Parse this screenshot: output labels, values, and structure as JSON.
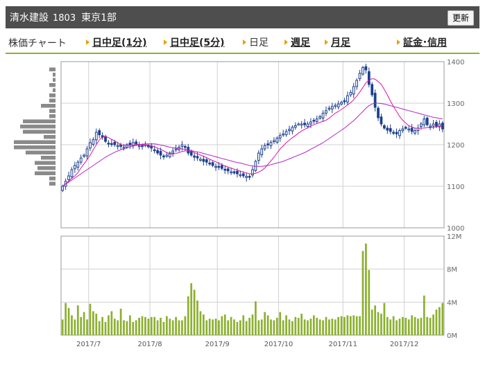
{
  "header": {
    "company": "清水建設",
    "code": "1803",
    "market": "東京1部",
    "refresh_label": "更新"
  },
  "nav": {
    "label": "株価チャート",
    "items": [
      {
        "label": "日中足(1分)",
        "current": false
      },
      {
        "label": "日中足(5分)",
        "current": false
      },
      {
        "label": "日足",
        "current": true
      },
      {
        "label": "週足",
        "current": false
      },
      {
        "label": "月足",
        "current": false
      },
      {
        "label": "証金･信用",
        "current": false
      }
    ]
  },
  "colors": {
    "candle": "#1a3f8f",
    "ma_short": "#d8159e",
    "ma_long": "#b023c8",
    "volume": "#8db030",
    "profile": "#8a8a8a",
    "grid": "#d0d0d0",
    "header_bg": "#4e4e4e"
  },
  "chart_data": [
    {
      "type": "candlestick",
      "x_ticks": [
        "2017/7",
        "2017/8",
        "2017/9",
        "2017/10",
        "2017/11",
        "2017/12"
      ],
      "y_ticks": [
        1400,
        1300,
        1200,
        1100,
        1000
      ],
      "ylim": [
        1000,
        1400
      ],
      "grid": true,
      "x": [
        "2017/6/20",
        "2017/6/21",
        "2017/6/22",
        "2017/6/23",
        "2017/6/26",
        "2017/6/27",
        "2017/6/28",
        "2017/6/29",
        "2017/6/30",
        "2017/7/3",
        "2017/7/4",
        "2017/7/5",
        "2017/7/6",
        "2017/7/7",
        "2017/7/10",
        "2017/7/11",
        "2017/7/12",
        "2017/7/13",
        "2017/7/14",
        "2017/7/18",
        "2017/7/19",
        "2017/7/20",
        "2017/7/21",
        "2017/7/24",
        "2017/7/25",
        "2017/7/26",
        "2017/7/27",
        "2017/7/28",
        "2017/7/31",
        "2017/8/1",
        "2017/8/2",
        "2017/8/3",
        "2017/8/4",
        "2017/8/7",
        "2017/8/8",
        "2017/8/9",
        "2017/8/10",
        "2017/8/14",
        "2017/8/15",
        "2017/8/16",
        "2017/8/17",
        "2017/8/18",
        "2017/8/21",
        "2017/8/22",
        "2017/8/23",
        "2017/8/24",
        "2017/8/25",
        "2017/8/28",
        "2017/8/29",
        "2017/8/30",
        "2017/8/31",
        "2017/9/1",
        "2017/9/4",
        "2017/9/5",
        "2017/9/6",
        "2017/9/7",
        "2017/9/8",
        "2017/9/11",
        "2017/9/12",
        "2017/9/13",
        "2017/9/14",
        "2017/9/15",
        "2017/9/19",
        "2017/9/20",
        "2017/9/21",
        "2017/9/22",
        "2017/9/25",
        "2017/9/26",
        "2017/9/27",
        "2017/9/28",
        "2017/9/29",
        "2017/10/2",
        "2017/10/3",
        "2017/10/4",
        "2017/10/5",
        "2017/10/6",
        "2017/10/10",
        "2017/10/11",
        "2017/10/12",
        "2017/10/13",
        "2017/10/16",
        "2017/10/17",
        "2017/10/18",
        "2017/10/19",
        "2017/10/20",
        "2017/10/23",
        "2017/10/24",
        "2017/10/25",
        "2017/10/26",
        "2017/10/27",
        "2017/10/30",
        "2017/10/31",
        "2017/11/1",
        "2017/11/2",
        "2017/11/6",
        "2017/11/7",
        "2017/11/8",
        "2017/11/9",
        "2017/11/10",
        "2017/11/13",
        "2017/11/14",
        "2017/11/15",
        "2017/11/16",
        "2017/11/17",
        "2017/11/20",
        "2017/11/21",
        "2017/11/22",
        "2017/11/24",
        "2017/11/27",
        "2017/11/28",
        "2017/11/29",
        "2017/11/30",
        "2017/12/1",
        "2017/12/4",
        "2017/12/5",
        "2017/12/6",
        "2017/12/7",
        "2017/12/8",
        "2017/12/11",
        "2017/12/12",
        "2017/12/13",
        "2017/12/14",
        "2017/12/15"
      ],
      "close": [
        1100,
        1112,
        1125,
        1140,
        1150,
        1158,
        1168,
        1175,
        1190,
        1205,
        1212,
        1230,
        1224,
        1218,
        1208,
        1203,
        1202,
        1200,
        1198,
        1196,
        1194,
        1200,
        1199,
        1205,
        1202,
        1198,
        1196,
        1200,
        1195,
        1192,
        1186,
        1180,
        1175,
        1172,
        1175,
        1180,
        1185,
        1190,
        1194,
        1200,
        1194,
        1180,
        1175,
        1170,
        1168,
        1165,
        1160,
        1158,
        1155,
        1150,
        1148,
        1146,
        1143,
        1140,
        1137,
        1135,
        1132,
        1130,
        1128,
        1125,
        1124,
        1123,
        1140,
        1160,
        1180,
        1190,
        1198,
        1200,
        1206,
        1210,
        1216,
        1222,
        1226,
        1232,
        1237,
        1242,
        1246,
        1250,
        1250,
        1248,
        1250,
        1255,
        1258,
        1262,
        1268,
        1276,
        1282,
        1288,
        1292,
        1295,
        1298,
        1302,
        1305,
        1318,
        1326,
        1340,
        1355,
        1372,
        1386,
        1380,
        1345,
        1320,
        1290,
        1265,
        1250,
        1240,
        1235,
        1232,
        1228,
        1226,
        1234,
        1238,
        1240,
        1238,
        1232,
        1234,
        1240,
        1250,
        1262,
        1248,
        1245,
        1250,
        1245,
        1250,
        1238
      ],
      "sma_short": [
        1100,
        1106,
        1112,
        1119,
        1125,
        1133,
        1144,
        1154,
        1164,
        1175,
        1188,
        1200,
        1212,
        1218,
        1220,
        1217,
        1213,
        1209,
        1205,
        1200,
        1198,
        1199,
        1199,
        1199,
        1200,
        1201,
        1200,
        1200,
        1199,
        1197,
        1195,
        1192,
        1189,
        1185,
        1181,
        1178,
        1178,
        1179,
        1181,
        1184,
        1185,
        1185,
        1184,
        1181,
        1178,
        1175,
        1172,
        1169,
        1165,
        1162,
        1159,
        1155,
        1152,
        1149,
        1146,
        1144,
        1141,
        1139,
        1136,
        1134,
        1132,
        1130,
        1130,
        1131,
        1134,
        1138,
        1144,
        1153,
        1161,
        1170,
        1180,
        1190,
        1197,
        1205,
        1211,
        1217,
        1222,
        1228,
        1233,
        1237,
        1241,
        1245,
        1248,
        1251,
        1254,
        1256,
        1259,
        1264,
        1270,
        1276,
        1280,
        1285,
        1290,
        1296,
        1301,
        1308,
        1317,
        1327,
        1338,
        1349,
        1355,
        1359,
        1358,
        1352,
        1345,
        1333,
        1320,
        1305,
        1292,
        1280,
        1268,
        1259,
        1252,
        1246,
        1243,
        1240,
        1240,
        1240,
        1240,
        1241,
        1241,
        1242,
        1243,
        1245,
        1245
      ],
      "sma_long": [
        1100,
        1105,
        1110,
        1115,
        1120,
        1125,
        1130,
        1135,
        1140,
        1145,
        1150,
        1155,
        1160,
        1165,
        1170,
        1174,
        1178,
        1182,
        1185,
        1188,
        1190,
        1193,
        1195,
        1197,
        1199,
        1200,
        1201,
        1202,
        1202,
        1202,
        1202,
        1201,
        1199,
        1198,
        1196,
        1194,
        1193,
        1192,
        1191,
        1190,
        1189,
        1188,
        1186,
        1184,
        1183,
        1181,
        1179,
        1177,
        1175,
        1173,
        1171,
        1169,
        1167,
        1165,
        1163,
        1161,
        1159,
        1157,
        1156,
        1154,
        1152,
        1150,
        1149,
        1148,
        1148,
        1148,
        1149,
        1150,
        1152,
        1154,
        1156,
        1158,
        1160,
        1163,
        1166,
        1169,
        1172,
        1175,
        1178,
        1181,
        1185,
        1189,
        1193,
        1197,
        1201,
        1205,
        1210,
        1215,
        1220,
        1225,
        1230,
        1235,
        1240,
        1246,
        1252,
        1258,
        1265,
        1273,
        1280,
        1288,
        1294,
        1298,
        1300,
        1300,
        1299,
        1298,
        1296,
        1294,
        1292,
        1290,
        1288,
        1286,
        1284,
        1282,
        1280,
        1278,
        1276,
        1274,
        1272,
        1270,
        1268,
        1266,
        1265,
        1263,
        1262
      ]
    },
    {
      "type": "bar",
      "y_ticks": [
        "12M",
        "8M",
        "4M",
        "0M"
      ],
      "ylim": [
        0,
        12
      ],
      "volume_millions": [
        1.9,
        3.9,
        3.3,
        2.4,
        1.9,
        3.6,
        2.2,
        2.8,
        1.9,
        3.8,
        2.9,
        2.6,
        1.7,
        2.2,
        1.6,
        2.4,
        2.9,
        2.0,
        1.8,
        3.2,
        1.8,
        1.7,
        2.4,
        1.6,
        1.8,
        2.1,
        2.3,
        2.2,
        2.0,
        2.2,
        2.2,
        1.8,
        2.1,
        1.6,
        2.3,
        2.0,
        1.8,
        2.2,
        1.8,
        1.8,
        2.3,
        4.7,
        6.3,
        5.5,
        4.2,
        2.9,
        2.5,
        1.8,
        2.0,
        1.9,
        2.0,
        1.8,
        2.3,
        2.5,
        1.8,
        2.2,
        1.9,
        1.6,
        1.8,
        2.4,
        1.7,
        2.1,
        2.5,
        4.1,
        1.8,
        1.9,
        2.8,
        2.4,
        1.9,
        1.8,
        2.1,
        2.8,
        1.8,
        2.4,
        1.9,
        1.7,
        2.2,
        2.1,
        2.6,
        1.9,
        1.8,
        2.0,
        2.4,
        2.1,
        1.9,
        1.8,
        2.2,
        1.9,
        2.0,
        1.9,
        2.2,
        2.3,
        2.2,
        2.4,
        2.3,
        2.4,
        2.3,
        2.3,
        10.2,
        11.1,
        7.9,
        3.1,
        3.6,
        2.8,
        2.6,
        3.9,
        2.2,
        1.9,
        2.3,
        1.8,
        2.0,
        2.2,
        2.1,
        1.9,
        2.4,
        2.2,
        2.0,
        2.1,
        4.8,
        2.2,
        2.1,
        2.5,
        3.1,
        3.4,
        3.9
      ]
    }
  ]
}
